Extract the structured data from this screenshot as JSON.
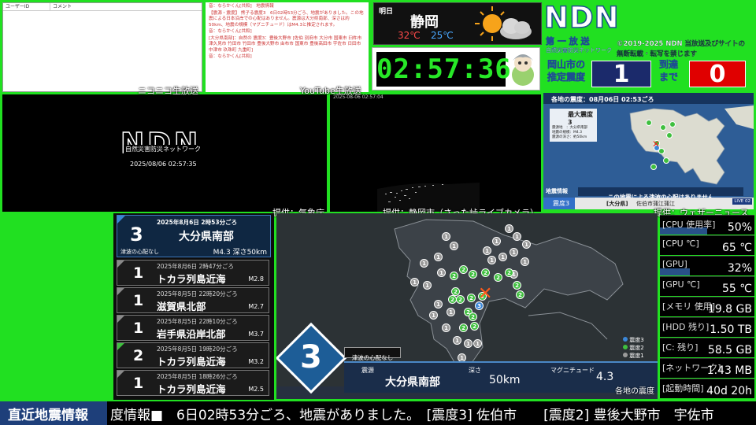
{
  "comment_table": {
    "col_user": "ユーザーID",
    "col_comment": "コメント"
  },
  "chat": {
    "lines": [
      "音：ならかくん[共和]　地震情報",
      "【震源・震度】 熊子る震度3　6日02時53分ごろ、地震がありました。この地震による日本沿岸での心配はありません。震源は大分県南部、深さは約50km、地震の規模（マグニチュード）はM4.3と推定されます。",
      "音：ならかくん[共和]",
      "[大分県南部]：自然の 震度3：豊後大野市 [佐伯 別府市 大分市 国東市 臼杵市 津久見市 竹田市 竹田市 豊後大野市 由布市 国東市 豊後高田市 宇佐市 日田市 中津市 玖珠町 九重町]",
      "音：ならかくん[共和]"
    ]
  },
  "weather": {
    "day": "明日",
    "city": "静岡",
    "high": "32℃",
    "low": "25℃",
    "icon": "sun-cloud-icon"
  },
  "clock": {
    "time": "02:57:36"
  },
  "ndn_header": {
    "logo": "NDN",
    "subtitle": "第 一 放 送",
    "subtitle2": "自然災害防災ネットワーク",
    "copyright": "©2019-2025 NDN 当放送及びサイトの",
    "copyright2": "無断転載・転写を禁じます"
  },
  "arrival": {
    "place": "岡山市の",
    "label": "推定震度",
    "shindo": "1",
    "until": "到達",
    "until2": "まで",
    "countdown": "0"
  },
  "labels": {
    "nico": "ニコニコ生放送",
    "youtube": "YouTube生放送",
    "jma": "提供：気象庁",
    "shizuoka_cam": "提供：静岡市（さった峠ライブカメラ）",
    "weathernews": "提供：ウェザーニュース"
  },
  "ndn_screen": {
    "logo": "NDN",
    "tagline": "自然災害防災ネットワーク",
    "timestamp": "2025/08/06 02:57:35"
  },
  "camera": {
    "overlay": "2025-08-06 02:57:04"
  },
  "news_map": {
    "header": "各地の震度：08月06日 02:53ごろ",
    "box_title": "最大震度 3",
    "box_lines": [
      "震源地　：大分県南部",
      "地震の規模：M4.3",
      "震源の深さ：約50km"
    ],
    "tsunami": "この地震による津波の心配はありません",
    "tag": "地震情報",
    "footer_shindo": "震度3",
    "footer_place": "[大分県]",
    "footer_city": "佐伯市蒲江蒲江",
    "brand": "LIVE 02"
  },
  "quake_list": {
    "top": {
      "datetime": "2025年8月6日 2時53分ごろ",
      "shindo": "3",
      "place": "大分県南部",
      "tsunami": "津波の心配なし",
      "mag": "M4.3 深さ50km"
    },
    "items": [
      {
        "datetime": "2025年8月6日 2時47分ごろ",
        "shindo": "1",
        "place": "トカラ列島近海",
        "mag": "M2.8"
      },
      {
        "datetime": "2025年8月5日 22時20分ごろ",
        "shindo": "1",
        "place": "滋賀県北部",
        "mag": "M2.7"
      },
      {
        "datetime": "2025年8月5日 22時10分ごろ",
        "shindo": "1",
        "place": "岩手県沿岸北部",
        "mag": "M3.7"
      },
      {
        "datetime": "2025年8月5日 19時20分ごろ",
        "shindo": "2",
        "place": "トカラ列島近海",
        "mag": "M3.2"
      },
      {
        "datetime": "2025年8月5日 18時26分ごろ",
        "shindo": "1",
        "place": "トカラ列島近海",
        "mag": "M2.5"
      }
    ]
  },
  "main_map": {
    "legend": [
      "震度3",
      "震度2",
      "震度1"
    ],
    "shindo": "3",
    "tsunami": "津波の心配なし",
    "epicenter_label": "震源",
    "epicenter": "大分県南部",
    "depth_label": "深さ",
    "depth": "50km",
    "mag_label": "マグニチュード",
    "mag": "4.3",
    "caption": "各地の震度"
  },
  "stats": [
    {
      "key": "[CPU 使用率]",
      "value": "50%",
      "fill": 0.5
    },
    {
      "key": "[CPU ℃]",
      "value": "65 ℃",
      "fill": 0.0
    },
    {
      "key": "[GPU]",
      "value": "32%",
      "fill": 0.32
    },
    {
      "key": "[GPU ℃]",
      "value": "55 ℃",
      "fill": 0.0
    },
    {
      "key": "[メモリ 使用]",
      "value": "19.8 GB",
      "fill": 0.0
    },
    {
      "key": "[HDD 残り]",
      "value": "1.50 TB",
      "fill": 0.0
    },
    {
      "key": "[C: 残り]",
      "value": "58.5 GB",
      "fill": 0.0
    },
    {
      "key": "[ネットワーク]",
      "value": "1.43 MB",
      "fill": 0.0
    },
    {
      "key": "[起動時間]",
      "value": "40d 20h",
      "fill": 0.0
    }
  ],
  "ticker": {
    "label": "直近地震情報",
    "text": "度情報■　6日02時53分ごろ、地震がありました。　[震度3] 佐伯市　　[震度2] 豊後大野市　宇佐市"
  }
}
